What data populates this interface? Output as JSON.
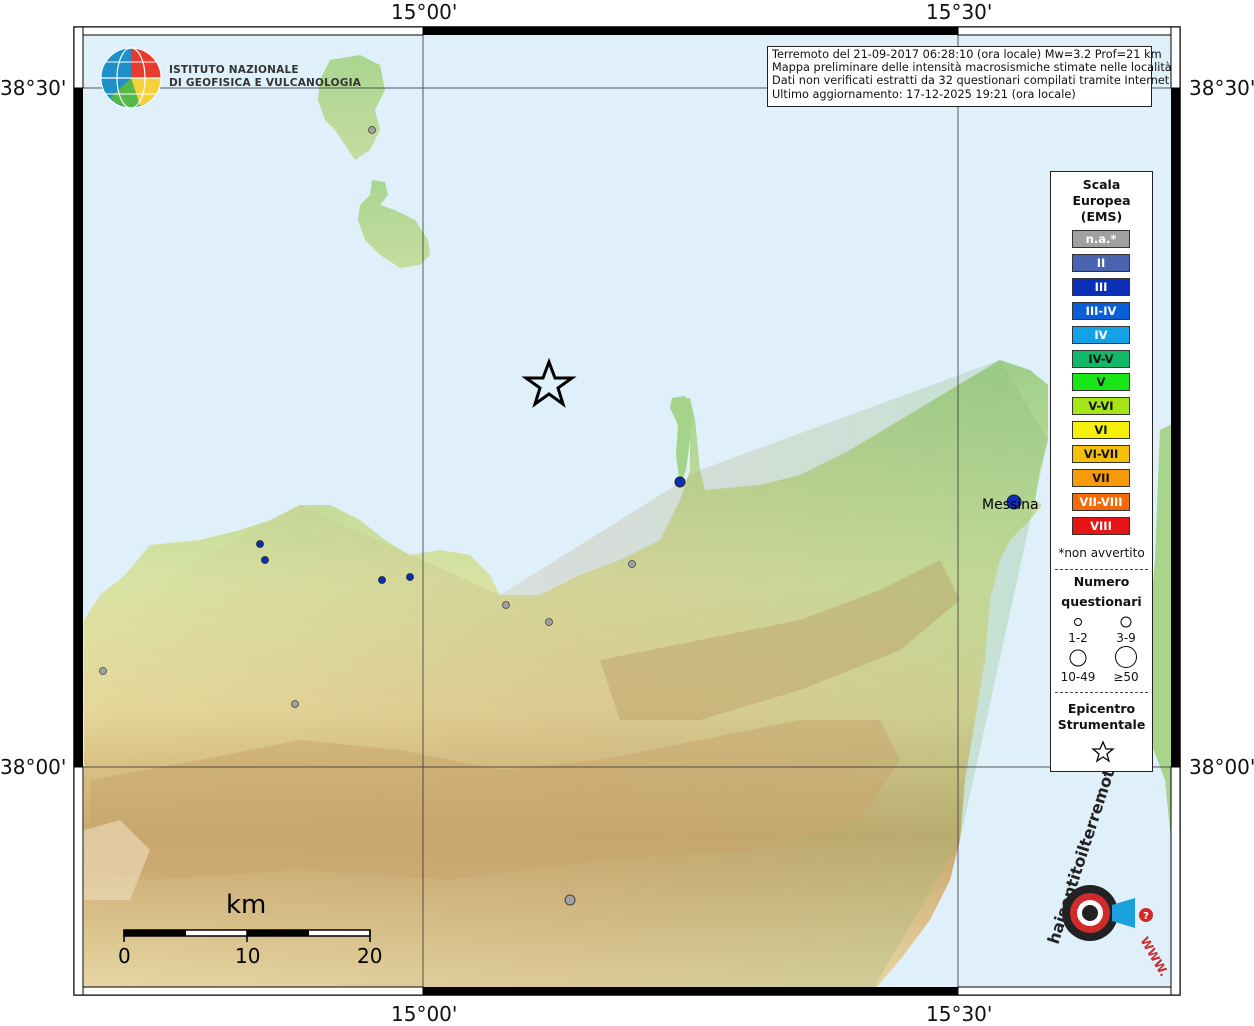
{
  "header": {
    "info_lines": [
      "Terremoto del 21-09-2017 06:28:10 (ora locale) Mw=3.2 Prof=21 km",
      "Mappa preliminare delle intensità macrosismiche stimate nelle località",
      "Dati non verificati estratti da 32 questionari compilati tramite Internet.",
      "Ultimo aggiornamento: 17-12-2025 19:21 (ora locale)"
    ]
  },
  "logo": {
    "line1": "ISTITUTO NAZIONALE",
    "line2": "DI GEOFISICA E VULCANOLOGIA",
    "icon": "ingv-globe-logo"
  },
  "axes": {
    "lon_top_left": "15°00'",
    "lon_top_right": "15°30'",
    "lon_bottom_left": "15°00'",
    "lon_bottom_right": "15°30'",
    "lat_upper_left": "38°30'",
    "lat_upper_right": "38°30'",
    "lat_lower_left": "38°00'",
    "lat_lower_right": "38°00'"
  },
  "legend": {
    "title_1": "Scala",
    "title_2": "Europea",
    "title_3": "(EMS)",
    "scale": [
      {
        "label": "n.a.*",
        "color": "#a0a0a0"
      },
      {
        "label": "II",
        "color": "#4a63b0"
      },
      {
        "label": "III",
        "color": "#0c2fb8"
      },
      {
        "label": "III-IV",
        "color": "#0a5fd6"
      },
      {
        "label": "IV",
        "color": "#12a3e6"
      },
      {
        "label": "IV-V",
        "color": "#12b86a"
      },
      {
        "label": "V",
        "color": "#19e619"
      },
      {
        "label": "V-VI",
        "color": "#a6e619"
      },
      {
        "label": "VI",
        "color": "#f4f00a"
      },
      {
        "label": "VI-VII",
        "color": "#f4c00a"
      },
      {
        "label": "VII",
        "color": "#f79a0a"
      },
      {
        "label": "VII-VIII",
        "color": "#f26a0a"
      },
      {
        "label": "VIII",
        "color": "#e61414"
      }
    ],
    "not_felt": "*non avvertito",
    "count_title_1": "Numero",
    "count_title_2": "questionari",
    "counts": [
      "1-2",
      "3-9",
      "10-49",
      "≥50"
    ],
    "epicenter_1": "Epicentro",
    "epicenter_2": "Strumentale",
    "star_icon": "star-icon"
  },
  "places": {
    "messina": "Messina"
  },
  "scale_bar": {
    "unit": "km",
    "ticks": [
      "0",
      "10",
      "20"
    ]
  },
  "badge": {
    "text": "haisentitoilterremoto.it",
    "url_text": "WWW.",
    "icon": "hai-sentito-logo"
  },
  "colors": {
    "sea": "#dff0fb",
    "frame": "#000000"
  },
  "observations": [
    {
      "ems": "III",
      "count": "10-49",
      "place": "Messina"
    },
    {
      "ems": "III",
      "count": "3-9"
    },
    {
      "ems": "III",
      "count": "1-2"
    },
    {
      "ems": "III",
      "count": "1-2"
    },
    {
      "ems": "III",
      "count": "1-2"
    },
    {
      "ems": "III",
      "count": "1-2"
    },
    {
      "ems": "n.a.*",
      "count": "1-2"
    },
    {
      "ems": "n.a.*",
      "count": "1-2"
    },
    {
      "ems": "n.a.*",
      "count": "1-2"
    },
    {
      "ems": "n.a.*",
      "count": "1-2"
    },
    {
      "ems": "n.a.*",
      "count": "1-2"
    },
    {
      "ems": "n.a.*",
      "count": "1-2"
    },
    {
      "ems": "n.a.*",
      "count": "3-9"
    }
  ]
}
